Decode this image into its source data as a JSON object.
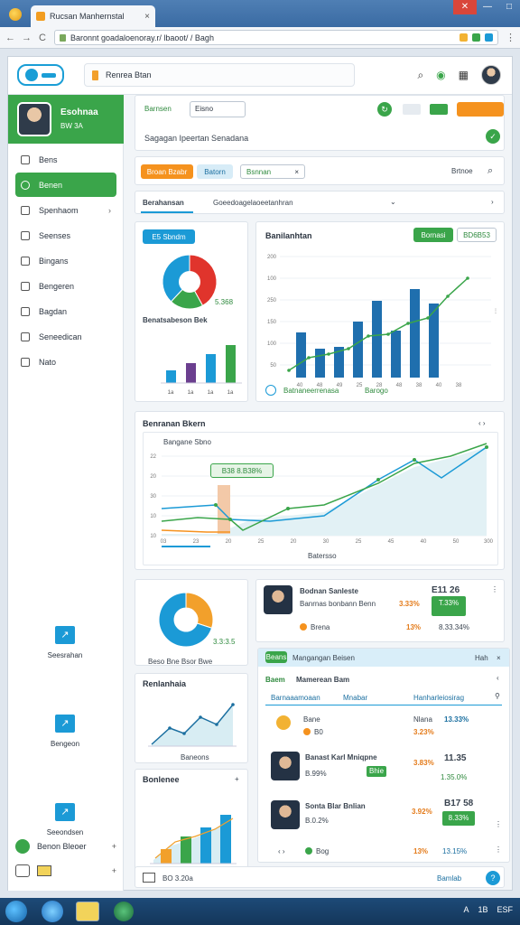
{
  "browser": {
    "tab_title": "Rucsan Manhernstal",
    "url": "Baronnt goadaloenoray.r/ lbaoot/ / Bagh",
    "nav_back": "←",
    "nav_forward": "→",
    "nav_reload": "C",
    "tab_close": "×",
    "win_min": "—",
    "win_max": "□",
    "win_close": "✕"
  },
  "topbar": {
    "search_text": "Renrea Btan",
    "icons": [
      "search-icon",
      "globe-icon",
      "grid-icon"
    ]
  },
  "sidebar": {
    "profile_name": "Esohnaa",
    "profile_sub": "BW 3A",
    "items": [
      {
        "label": "Bens",
        "active": false,
        "chevron": ""
      },
      {
        "label": "Benen",
        "active": true,
        "chevron": ""
      },
      {
        "label": "Spenhaom",
        "active": false,
        "chevron": "›"
      },
      {
        "label": "Seenses",
        "active": false,
        "chevron": ""
      },
      {
        "label": "Bingans",
        "active": false,
        "chevron": ""
      },
      {
        "label": "Bengeren",
        "active": false,
        "chevron": ""
      },
      {
        "label": "Bagdan",
        "active": false,
        "chevron": ""
      },
      {
        "label": "Seneedican",
        "active": false,
        "chevron": ""
      },
      {
        "label": "Nato",
        "active": false,
        "chevron": ""
      }
    ],
    "actions": [
      "Seesrahan",
      "Bengeon",
      "Seeondsen"
    ],
    "action_icons": [
      "↗",
      "↗",
      "↗"
    ],
    "bottom_1": "Benon Bleoer",
    "bottom_1_plus": "+",
    "bottom_2_plus": "+"
  },
  "header_card": {
    "label": "Barnsen",
    "field_value": "Eisno",
    "subtitle": "Sagagan Ipeertan Senadana",
    "check": "✓"
  },
  "filters": {
    "chip_orange": "Broan Bzabr",
    "chip_blue": "Batorn",
    "chip_green": "Bsnnan",
    "chip_close": "×",
    "right_label": "Brtnoe"
  },
  "tabs": {
    "active": "Berahansan",
    "other": "Goeedoagelaoeetanhran",
    "more": "›"
  },
  "chart_card_1": {
    "badge": "E5 Sbndm",
    "pie_label": "5.368",
    "section_title": "Benatsabeson   Bek",
    "bar_labels": [
      "1a",
      "1a",
      "1a",
      "1a"
    ]
  },
  "chart_card_2": {
    "title": "Banilanhtan",
    "btn_green": "Bornasi",
    "btn_outline": "BD6B53",
    "x_labels": [
      "40",
      "48",
      "49",
      "25",
      "28",
      "48",
      "38",
      "40",
      "38"
    ],
    "y_labels": [
      "200",
      "100",
      "250",
      "150",
      "100",
      "50"
    ],
    "legend_1": "Batnaneerrenasa",
    "legend_2": "Barogo"
  },
  "chart_area_card": {
    "title": "Benranan Bkern",
    "subtitle": "Bangane Sbno",
    "callout": "B38 8.B38%",
    "legend": "Batersso",
    "x_labels": [
      "03",
      "23",
      "20",
      "25",
      "20",
      "30",
      "25",
      "45",
      "40",
      "50",
      "300"
    ],
    "y_labels": [
      "22",
      "20",
      "30",
      "10",
      "10"
    ]
  },
  "lower_left": {
    "donut_label": "3.3:3.5",
    "stats_line": "Beso Bne Bsor Bwe",
    "card2_title": "Renlanhaia",
    "card2_axis": "Baneons",
    "card3_title": "Bonlenee",
    "card3_plus": "+",
    "card3_footer": "B0 3.20a"
  },
  "people_top": {
    "name": "Bodnan Sanleste",
    "sub": "Banrnas bonbann Benn",
    "amount": "E11 26",
    "pct": "3.33%",
    "badge": "T.33%",
    "row_label": "Brena",
    "row_pct": "13%",
    "row_amount": "8.33.34%",
    "more": "⋮"
  },
  "panel": {
    "header_badge": "Beans",
    "header_title": "Mangangan Beisen",
    "header_right": "Hah",
    "sub_label": "Baem",
    "sub_title": "Mamerean Bam",
    "col_1": "Barnaaamoaan",
    "col_2": "Mnabar",
    "col_3": "Hanharleiosirag",
    "row1": {
      "label": "Bane",
      "sub": "B0",
      "name": "Nlana",
      "pct": "3.23%",
      "amount": "13.33%"
    },
    "person1": {
      "name": "Banast Karl Mniqpne",
      "sub": "B.99%",
      "tag": "Bhie",
      "pct": "3.83%",
      "amount": "11.35",
      "amount2": "1.35.0%"
    },
    "person2": {
      "name": "Sonta Blar Bnlian",
      "sub": "B.0.2%",
      "pct": "3.92%",
      "amount": "B17 58",
      "badge": "8.33%"
    },
    "row_last": {
      "label": "Bog",
      "pct": "13%",
      "amount": "13.15%"
    }
  },
  "footer_bar": {
    "left": "BO 3.20a",
    "right": "Bamlab"
  },
  "taskbar": {
    "tray_a": "A",
    "tray_b": "1B",
    "tray_c": "ESF"
  },
  "colors": {
    "accent_green": "#3aa54a",
    "accent_blue": "#1b9ad6",
    "accent_orange": "#f5921e",
    "accent_red": "#e0342c"
  }
}
